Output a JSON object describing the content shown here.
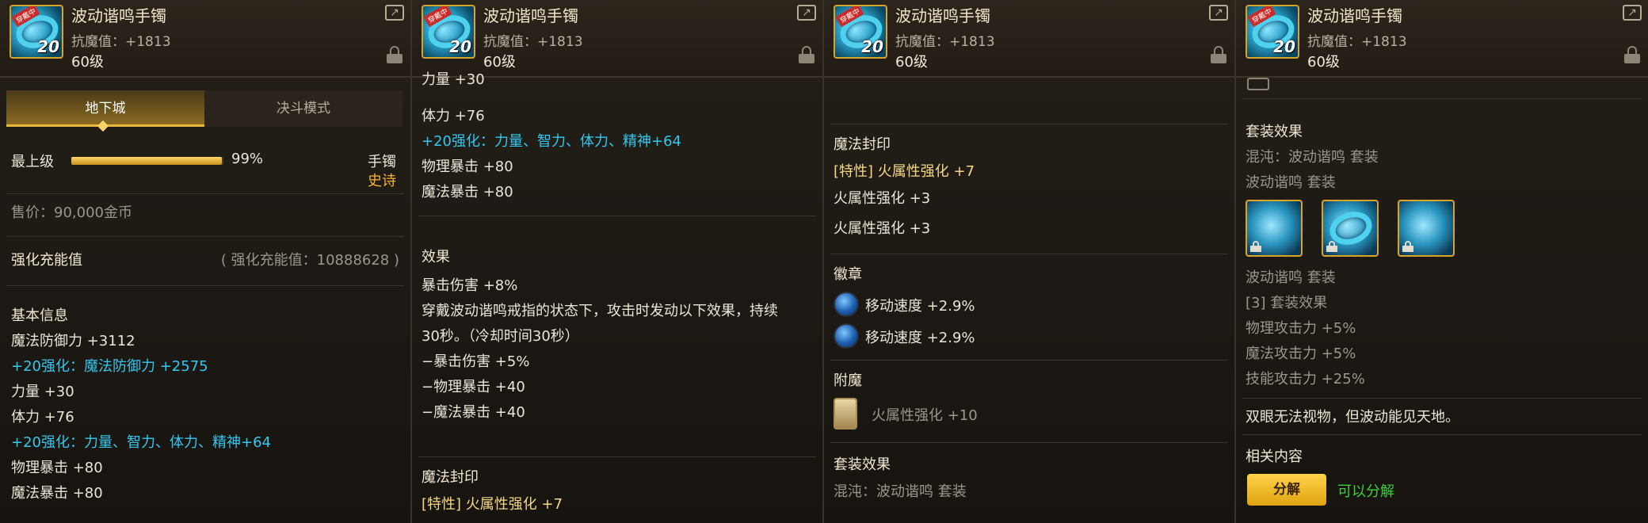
{
  "item": {
    "name": "波动谐鸣手镯",
    "stat": "抗魔值：+1813",
    "level": "60级",
    "icon_tag": "穿戴中",
    "icon_number": "20"
  },
  "icons": {
    "share": "share-icon",
    "lock": "lock-icon"
  },
  "panel1": {
    "tabs": [
      "地下城",
      "决斗模式"
    ],
    "grade_label": "最上级",
    "grade_percent": "99%",
    "grade_value": 0.99,
    "slot": "手镯",
    "rarity": "史诗",
    "price": "售价：90,000金币",
    "amp_label": "强化充能值",
    "amp_value": "( 强化充能值：10888628 )",
    "basic_title": "基本信息",
    "lines": [
      "魔法防御力 +3112",
      "+20强化：魔法防御力 +2575",
      "力量 +30",
      "体力 +76",
      "+20强化：力量、智力、体力、精神+64",
      "物理暴击 +80",
      "魔法暴击 +80"
    ]
  },
  "panel2": {
    "lines_top": [
      "力量 +30",
      "体力 +76",
      "+20强化：力量、智力、体力、精神+64",
      "物理暴击 +80",
      "魔法暴击 +80"
    ],
    "effect_title": "效果",
    "effect_lines": [
      "暴击伤害 +8%",
      "穿戴波动谐鸣戒指的状态下，攻击时发动以下效果，持续",
      "30秒。（冷却时间30秒）",
      "−暴击伤害 +5%",
      "−物理暴击 +40",
      "−魔法暴击 +40"
    ],
    "seal_title": "魔法封印",
    "seal_line": "[特性] 火属性强化 +7"
  },
  "panel3": {
    "seal_title": "魔法封印",
    "seal_lines": [
      "[特性] 火属性强化 +7",
      "火属性强化 +3",
      "火属性强化 +3"
    ],
    "emblem_title": "徽章",
    "emblem_lines": [
      "移动速度 +2.9%",
      "移动速度 +2.9%"
    ],
    "enchant_title": "附魔",
    "enchant_line": "火属性强化 +10",
    "set_title": "套装效果",
    "set_line": "混沌：波动谐鸣 套装"
  },
  "panel4": {
    "set_title": "套装效果",
    "set_lines": [
      "混沌：波动谐鸣 套装",
      "波动谐鸣 套装"
    ],
    "set_name2": "波动谐鸣 套装",
    "set_bonus_title": "[3] 套装效果",
    "bonus_lines": [
      "物理攻击力 +5%",
      "魔法攻击力 +5%",
      "技能攻击力 +25%"
    ],
    "flavor": "双眼无法视物，但波动能见天地。",
    "related_title": "相关内容",
    "decompose_button": "分解",
    "decompose_status": "可以分解"
  }
}
